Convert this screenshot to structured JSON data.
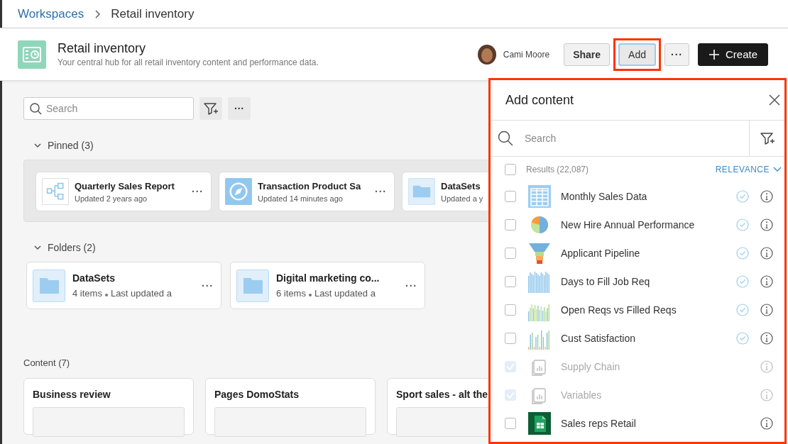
{
  "breadcrumb": [
    {
      "label": "Workspaces",
      "link": true
    },
    {
      "label": "Retail inventory",
      "link": false
    }
  ],
  "header": {
    "title": "Retail inventory",
    "subtitle": "Your central hub for all retail inventory content and performance data.",
    "user": "Cami Moore",
    "buttons": [
      {
        "label": "Share",
        "kind": "plain",
        "highlighted": false
      },
      {
        "label": "Add",
        "kind": "plain",
        "highlighted": true
      },
      {
        "label": "···",
        "kind": "more",
        "highlighted": false
      },
      {
        "label": "Create",
        "kind": "primary",
        "highlighted": false
      }
    ]
  },
  "toolbar": {
    "search": {
      "placeholder": "Search"
    },
    "more": "···"
  },
  "pinned": {
    "title": "Pinned (3)",
    "expanded": true,
    "items": [
      {
        "kind": "flow",
        "name": "Quarterly Sales Report",
        "meta": "Updated 2 years ago",
        "more": "···"
      },
      {
        "kind": "compass",
        "name": "Transaction Product Sa",
        "meta": "Updated 14 minutes ago",
        "more": "···"
      },
      {
        "kind": "folder",
        "name": "DataSets",
        "meta": "Updated a y"
      }
    ]
  },
  "folders": {
    "title": "Folders (2)",
    "expanded": true,
    "items": [
      {
        "name": "DataSets",
        "count": "4 items",
        "meta": "Last updated a",
        "more": "···"
      },
      {
        "name": "Digital marketing co...",
        "count": "6 items",
        "meta": "Last updated a",
        "more": "···"
      }
    ]
  },
  "content": {
    "title": "Content (7)",
    "items": [
      {
        "name": "Business review"
      },
      {
        "name": "Pages DomoStats"
      },
      {
        "name": "Sport sales - alt the"
      }
    ]
  },
  "panel": {
    "title": "Add content",
    "highlighted": true,
    "search": {
      "placeholder": "Search"
    },
    "results": "Results (22,087)",
    "all_checked": false,
    "sort": "RELEVANCE",
    "items": [
      {
        "name": "Monthly Sales Data",
        "kind": "table",
        "checked": false,
        "disabled": false,
        "certified": true
      },
      {
        "name": "New Hire Annual Performance",
        "kind": "pie",
        "checked": false,
        "disabled": false,
        "certified": true
      },
      {
        "name": "Applicant Pipeline",
        "kind": "funnel",
        "checked": false,
        "disabled": false,
        "certified": true
      },
      {
        "name": "Days to Fill Job Req",
        "kind": "bars",
        "checked": false,
        "disabled": false,
        "certified": true
      },
      {
        "name": "Open Reqs vs Filled Reqs",
        "kind": "multibars",
        "checked": false,
        "disabled": false,
        "certified": true
      },
      {
        "name": "Cust Satisfaction",
        "kind": "thinbars",
        "checked": false,
        "disabled": false,
        "certified": true
      },
      {
        "name": "Supply Chain",
        "kind": "card",
        "checked": true,
        "disabled": true,
        "certified": false
      },
      {
        "name": "Variables",
        "kind": "card",
        "checked": true,
        "disabled": true,
        "certified": false
      },
      {
        "name": "Sales reps Retail",
        "kind": "sheet",
        "checked": false,
        "disabled": false,
        "certified": false
      }
    ]
  }
}
